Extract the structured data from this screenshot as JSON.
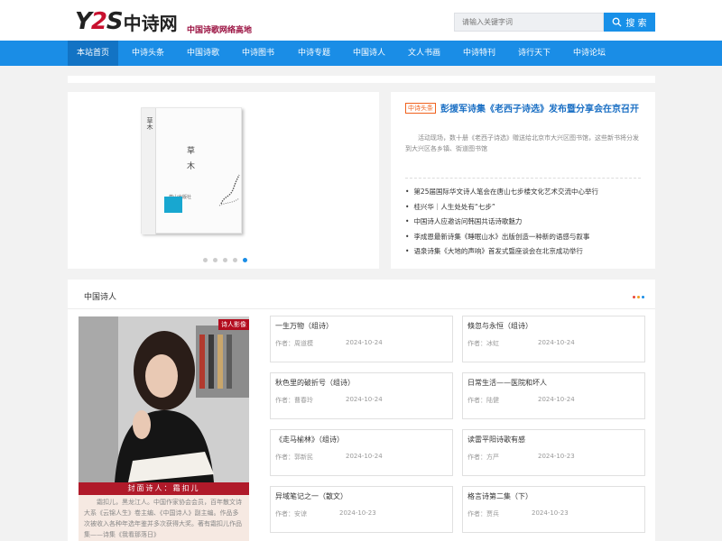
{
  "header": {
    "logo_y": "Y",
    "logo_2": "2",
    "logo_s": "S",
    "logo_cn": "中诗网",
    "slogan": "中国诗歌网络高地",
    "search_placeholder": "请输入关键字词",
    "search_button": "搜 索"
  },
  "nav": {
    "items": [
      "本站首页",
      "中诗头条",
      "中国诗歌",
      "中诗图书",
      "中诗专题",
      "中国诗人",
      "文人书画",
      "中诗特刊",
      "诗行天下",
      "中诗论坛"
    ],
    "active_index": 0
  },
  "slider": {
    "book_title": "草木",
    "book_publisher": "燕山出版社",
    "slide_count": 5,
    "active_slide": 5
  },
  "headline": {
    "tag": "中诗头条",
    "title": "彭援军诗集《老西子诗选》发布暨分享会在京召开",
    "summary": "活动现场，数十册《老西子诗选》赠送给北京市大兴区图书馆，这些新书将分发到大兴区各乡镇、街道图书馆",
    "list": [
      "第25届国际华文诗人笔会在唐山七步楼文化艺术交流中心举行",
      "桂兴华｜人生处处有“七步”",
      "中国诗人应邀访问韩国共话诗歌魅力",
      "李成恩最新诗集《睡眠山水》出版创造一种新的语感与叙事",
      "语泉诗集《大地的声响》首发式暨座谈会在北京成功举行"
    ]
  },
  "section": {
    "title": "中国诗人",
    "dot_colors": [
      "#e8463a",
      "#f0a020",
      "#1a8de6"
    ]
  },
  "featured_poet": {
    "badge": "诗人影像",
    "caption": "封面诗人：霜扣儿",
    "bio": "霜扣儿，黑龙江人。中国作家协会会员，百年散文诗大系《云锦人生》卷主编、《中国诗人》副主编。作品多次被收入各种年选年鉴并多次获得大奖。著有霜扣儿作品集——诗集《我看那落日》"
  },
  "author_prefix": "作者：",
  "poems": [
    {
      "title": "一生万物（组诗）",
      "author": "周道模",
      "date": "2024-10-24"
    },
    {
      "title": "倏忽与永恒（组诗）",
      "author": "冰虹",
      "date": "2024-10-24"
    },
    {
      "title": "秋色里的破折号（组诗）",
      "author": "曹春玲",
      "date": "2024-10-24"
    },
    {
      "title": "日常生活——医院和坏人",
      "author": "陆健",
      "date": "2024-10-24"
    },
    {
      "title": "《走马榆林》（组诗）",
      "author": "郭新民",
      "date": "2024-10-24"
    },
    {
      "title": "读雷平阳诗歌有感",
      "author": "方严",
      "date": "2024-10-23"
    },
    {
      "title": "异域笔记之一（散文）",
      "author": "安谅",
      "date": "2024-10-23"
    },
    {
      "title": "格言诗第二集（下）",
      "author": "贾兵",
      "date": "2024-10-23"
    }
  ]
}
